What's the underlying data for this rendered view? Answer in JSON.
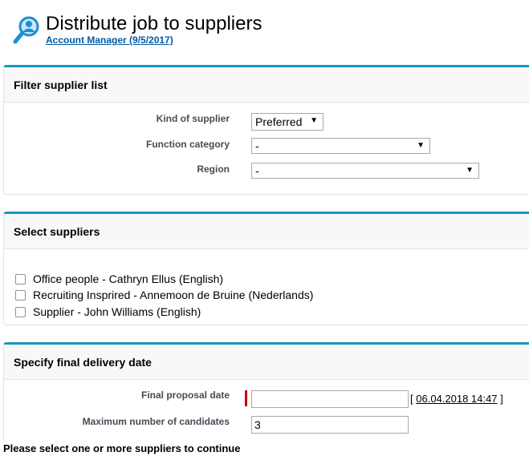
{
  "header": {
    "title": "Distribute job to suppliers",
    "subtitle": "Account Manager (9/5/2017)",
    "icon": "magnifier-user-icon"
  },
  "filter_section": {
    "title": "Filter supplier list",
    "kind_label": "Kind of supplier",
    "kind_value": "Preferred",
    "function_label": "Function category",
    "function_value": "-",
    "region_label": "Region",
    "region_value": "-"
  },
  "suppliers_section": {
    "title": "Select suppliers",
    "suppliers": [
      "Office people - Cathryn Ellus (English)",
      "Recruiting Insprired - Annemoon de Bruine (Nederlands)",
      "Supplier - John Williams (English)"
    ]
  },
  "delivery_section": {
    "title": "Specify final delivery date",
    "proposal_label": "Final proposal date",
    "proposal_value": "",
    "date_bracket_open": "[",
    "date_link": "06.04.2018 14:47",
    "date_bracket_close": "]",
    "max_candidates_label": "Maximum number of candidates",
    "max_candidates_value": "3"
  },
  "footer": {
    "message": "Please select one or more suppliers to continue"
  },
  "colors": {
    "accent": "#1797c0",
    "link": "#015ba7",
    "required": "#cc0000"
  }
}
